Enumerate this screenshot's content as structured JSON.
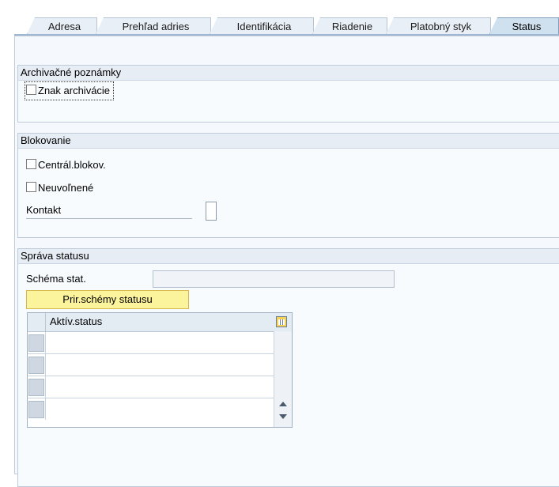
{
  "tabs": [
    {
      "label": "Adresa"
    },
    {
      "label": "Prehľad adries"
    },
    {
      "label": "Identifikácia"
    },
    {
      "label": "Riadenie"
    },
    {
      "label": "Platobný styk"
    },
    {
      "label": "Status"
    }
  ],
  "archive": {
    "title": "Archivačné poznámky",
    "checkbox_label": "Znak archivácie"
  },
  "blocking": {
    "title": "Blokovanie",
    "central_label": "Centrál.blokov.",
    "unreleased_label": "Neuvoľnené",
    "contact_label": "Kontakt"
  },
  "status_mgmt": {
    "title": "Správa statusu",
    "schema_label": "Schéma stat.",
    "schema_value": "",
    "assign_button": "Prir.schémy statusu",
    "table_column": "Aktív.status"
  }
}
